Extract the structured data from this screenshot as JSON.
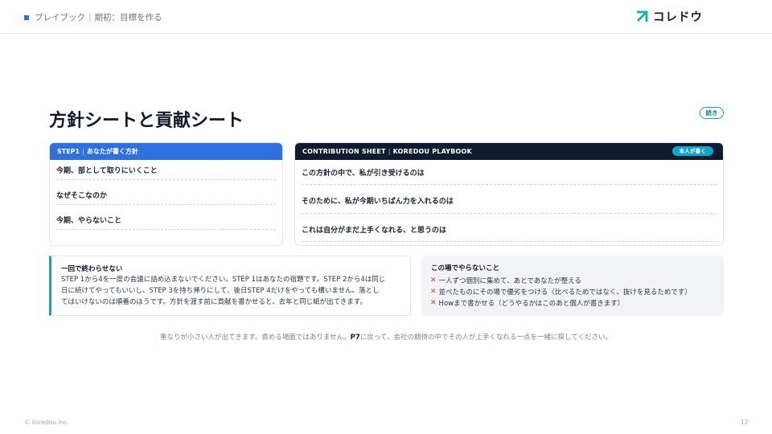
{
  "header": {
    "section": "プレイブック",
    "page": "期初：目標を作る",
    "brand": "コレドウ"
  },
  "title": "方針シートと貢献シート",
  "continued_badge": "続き",
  "left_card": {
    "step": "STEP1",
    "label": "あなたが書く方針",
    "rows": [
      "今期、部として取りにいくこと",
      "なぜそこなのか",
      "今期、やらないこと"
    ]
  },
  "right_card": {
    "title": "CONTRIBUTION SHEET",
    "subtitle": "KOREDOU PLAYBOOK",
    "pill": "本人が書く",
    "rows": [
      "この方針の中で、私が引き受けるのは",
      "そのために、私が今期いちばん力を入れるのは",
      "これは自分がまだ上手くなれる、と思うのは"
    ]
  },
  "note": {
    "title": "一回で終わらせない",
    "lines": [
      "STEP 1から4を一度の会議に詰め込まないでください。STEP 1はあなたの宿題です。STEP 2から4は同じ",
      "日に続けてやってもいいし、STEP 3を持ち帰りにして、後日STEP 4だけをやっても構いません。落とし",
      "てはいけないのは順番のほうです。方針を渡す前に貢献を書かせると、去年と同じ紙が出てきます。"
    ]
  },
  "dont_list": {
    "title": "この場でやらないこと",
    "items": [
      "一人ずつ個別に集めて、あとであなたが整える",
      "並べたものにその場で優劣をつける（比べるためではなく、抜けを見るためです）",
      "Howまで書かせる（どうやるかはこのあと個人が書きます）"
    ]
  },
  "footer": {
    "before": "重なりが小さい人が出てきます。責める場面ではありません。",
    "link": "P7",
    "after": "に戻って、会社の期待の中でその人が上手くなれる一点を一緒に探してください。",
    "copyright": "© koredou inc.",
    "page_number": "12"
  },
  "colors": {
    "accent_blue": "#2f6fde",
    "dark_navy": "#0f1b2e",
    "teal": "#1f9bc4",
    "cross_red": "#d43c3c"
  }
}
